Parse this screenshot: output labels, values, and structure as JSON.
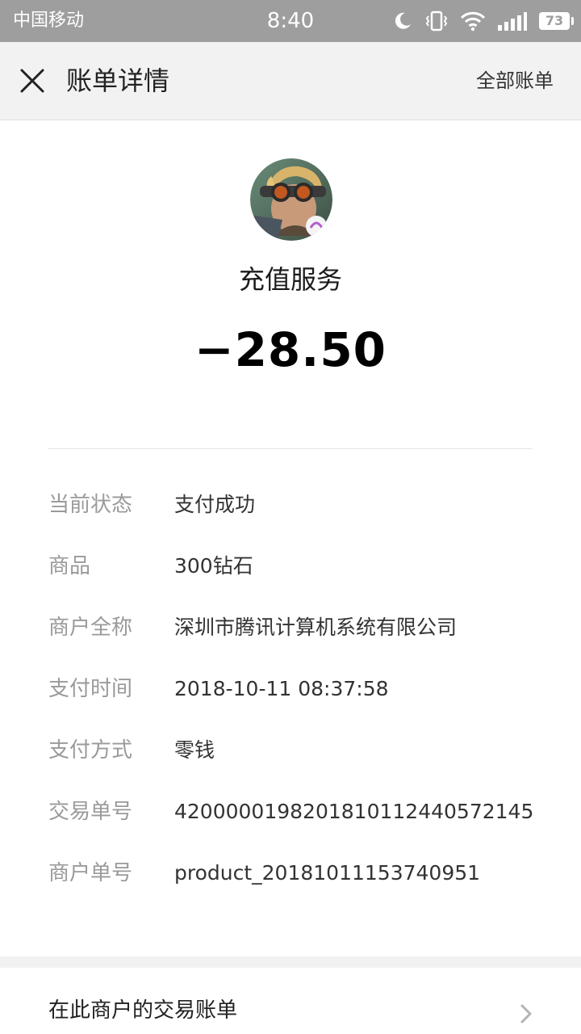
{
  "status_bar": {
    "carrier": "中国移动",
    "time": "8:40",
    "battery_level": "73",
    "icons": [
      "moon-icon",
      "vibrate-icon",
      "wifi-icon",
      "signal-icon",
      "battery-icon"
    ]
  },
  "navbar": {
    "title": "账单详情",
    "all_bills_label": "全部账单",
    "close_icon": "close-icon"
  },
  "header": {
    "merchant_name": "充值服务",
    "amount": "−28.50"
  },
  "details": [
    {
      "label": "当前状态",
      "value": "支付成功"
    },
    {
      "label": "商品",
      "value": "300钻石"
    },
    {
      "label": "商户全称",
      "value": "深圳市腾讯计算机系统有限公司"
    },
    {
      "label": "支付时间",
      "value": "2018-10-11 08:37:58"
    },
    {
      "label": "支付方式",
      "value": "零钱"
    },
    {
      "label": "交易单号",
      "value": "4200000198201810112440572145"
    },
    {
      "label": "商户单号",
      "value": "product_20181011153740951"
    }
  ],
  "footer": {
    "merchant_bills_label": "在此商户的交易账单",
    "chevron_icon": "chevron-right-icon"
  },
  "colors": {
    "status_bar_bg": "#9e9e9e",
    "navbar_bg": "#f2f2f2",
    "label_gray": "#9a9a9a",
    "value_dark": "#333333"
  }
}
